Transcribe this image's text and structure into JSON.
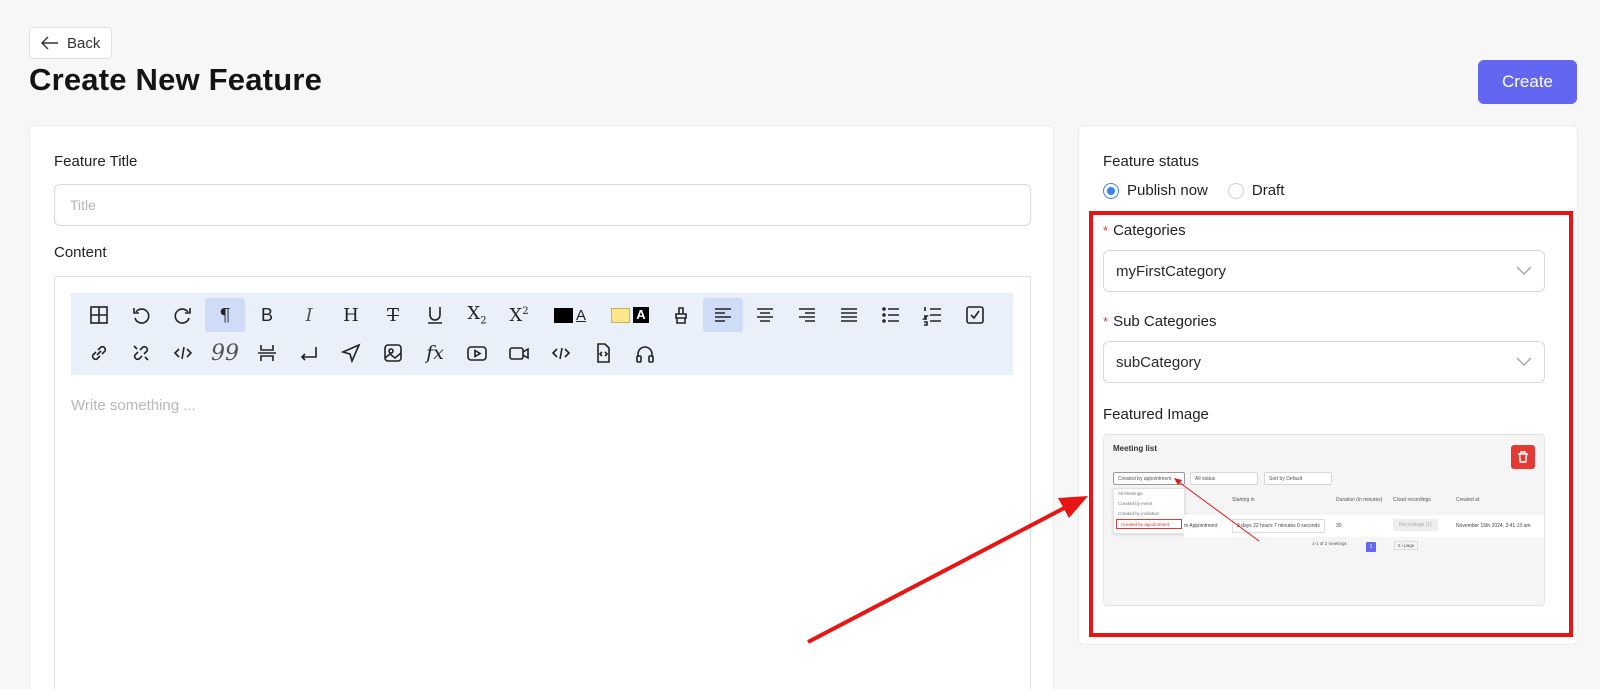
{
  "header": {
    "back_label": "Back",
    "page_title": "Create New Feature",
    "create_label": "Create"
  },
  "form": {
    "title_label": "Feature Title",
    "title_placeholder": "Title",
    "content_label": "Content",
    "content_placeholder": "Write something ..."
  },
  "toolbar": {
    "row1": [
      "table-icon",
      "undo-icon",
      "redo-icon",
      "paragraph-icon",
      "bold-icon",
      "italic-icon",
      "heading-icon",
      "strikethrough-icon",
      "underline-icon",
      "subscript-icon",
      "superscript-icon",
      "text-color-icon",
      "highlight-color-icon",
      "clear-format-icon",
      "align-left-icon",
      "align-center-icon",
      "align-right-icon",
      "align-justify-icon",
      "bullet-list-icon",
      "ordered-list-icon",
      "task-list-icon",
      "link-icon"
    ],
    "row2": [
      "unlink-icon",
      "code-icon",
      "blockquote-icon",
      "horizontal-rule-icon",
      "hard-break-icon",
      "send-icon",
      "image-icon",
      "formula-icon",
      "youtube-icon",
      "video-icon",
      "code-block-icon",
      "embed-icon",
      "audio-icon"
    ],
    "text_color": "#000000",
    "highlight_color": "#fde68a"
  },
  "sidebar": {
    "status_label": "Feature status",
    "status_options": [
      "Publish now",
      "Draft"
    ],
    "status_selected": "Publish now",
    "categories_label": "Categories",
    "categories_value": "myFirstCategory",
    "subcategories_label": "Sub Categories",
    "subcategories_value": "subCategory",
    "featured_image_label": "Featured Image"
  },
  "featured_image": {
    "title": "Meeting list",
    "filter1": "Created by appointment",
    "filter2": "All status",
    "filter3": "Sort by Default",
    "dropdown_items": [
      "All Meetings",
      "Created by event",
      "Created by invitation",
      "Created by appointment"
    ],
    "columns": [
      "Starting in",
      "Duration (in minutes)",
      "Cloud recordings",
      "Created at"
    ],
    "row": [
      "m Appointment",
      "3 days 22 hours 7 minutes 0 seconds",
      "30",
      "Recordings (1)",
      "November 15th 2024, 3:41:13 am"
    ],
    "pagination_text": "1-1 of 2 meetings",
    "page_number": "1",
    "page_size": "5 / page"
  },
  "colors": {
    "accent": "#6366f1",
    "annotation": "#e81515",
    "radio": "#3b82f6"
  }
}
